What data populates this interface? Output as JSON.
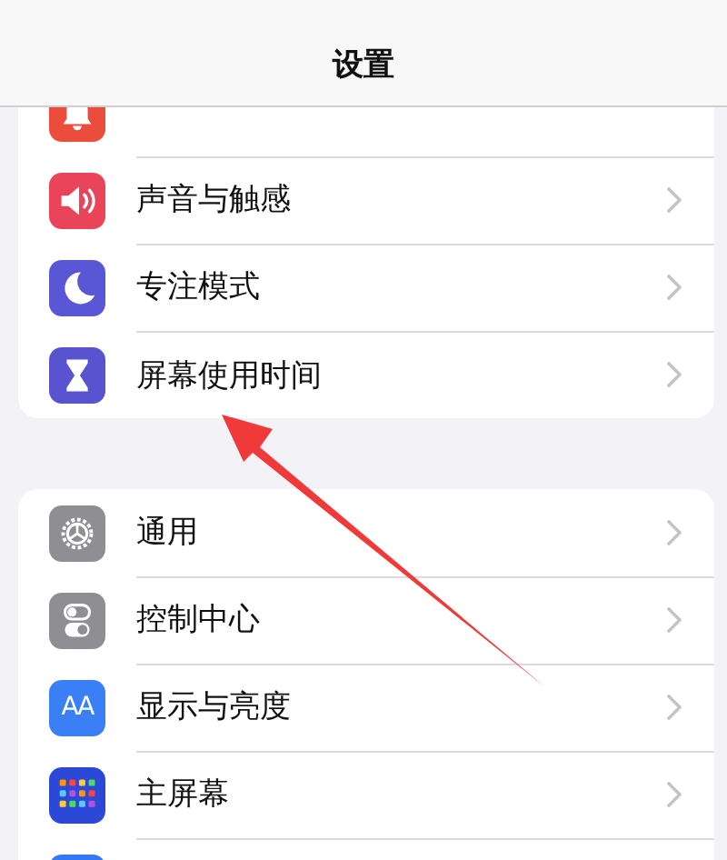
{
  "nav_bar": {
    "title": "设置"
  },
  "groups": [
    {
      "items": [
        {
          "kind": "bell",
          "color": "#eb4d3d"
        },
        {
          "label": "声音与触感",
          "kind": "speaker",
          "color": "#e9445a"
        },
        {
          "label": "专注模式",
          "kind": "moon",
          "color": "#5a57d6"
        },
        {
          "label": "屏幕使用时间",
          "kind": "hourglass",
          "color": "#5a53cf"
        }
      ]
    },
    {
      "items": [
        {
          "label": "通用",
          "kind": "gear",
          "color": "#8e8e93"
        },
        {
          "label": "控制中心",
          "kind": "toggles",
          "color": "#8e8e93"
        },
        {
          "label": "显示与亮度",
          "kind": "text",
          "icon_text": "AA",
          "color": "#3a7ff5"
        },
        {
          "label": "主屏幕",
          "kind": "grid",
          "color": "#2b48d6"
        },
        {
          "kind": "blank",
          "color": "#3478f6"
        }
      ]
    }
  ]
}
